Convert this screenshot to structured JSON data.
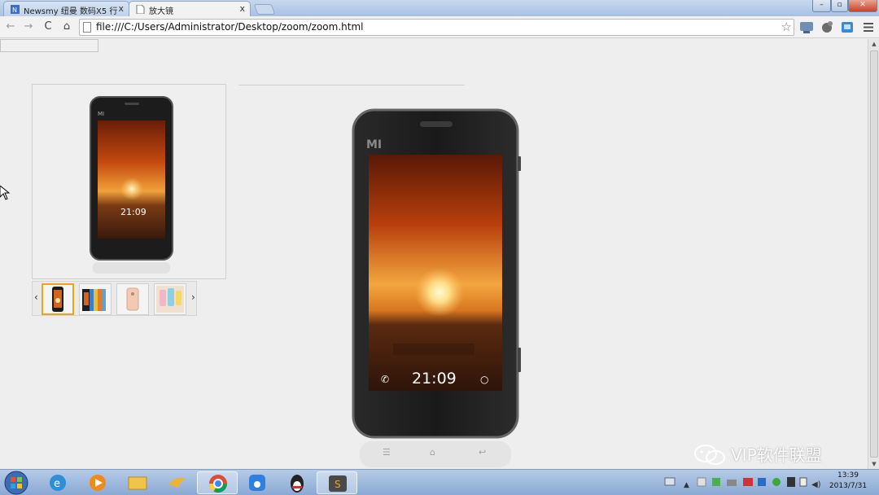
{
  "browser": {
    "tabs": [
      {
        "label": "Newsmy 纽曼 数码X5 行",
        "state": "inactive"
      },
      {
        "label": "放大镜",
        "state": "active"
      }
    ],
    "url": "file:///C:/Users/Administrator/Desktop/zoom/zoom.html"
  },
  "page": {
    "product_image": "phone-front-screen",
    "thumbnails": [
      {
        "name": "phone-front",
        "selected": true
      },
      {
        "name": "phone-color-lineup",
        "selected": false
      },
      {
        "name": "phone-back-pink",
        "selected": false
      },
      {
        "name": "phone-accessories",
        "selected": false
      }
    ],
    "phone": {
      "brand_mark": "MI",
      "time": "21:09"
    }
  },
  "taskbar": {
    "clock_time": "13:39",
    "clock_date": "2013/7/31"
  },
  "watermark": {
    "text": "VIP软件联盟"
  },
  "colors": {
    "accent_selected_thumb": "#f2a11b",
    "taskbar": "#9fb9dc"
  }
}
